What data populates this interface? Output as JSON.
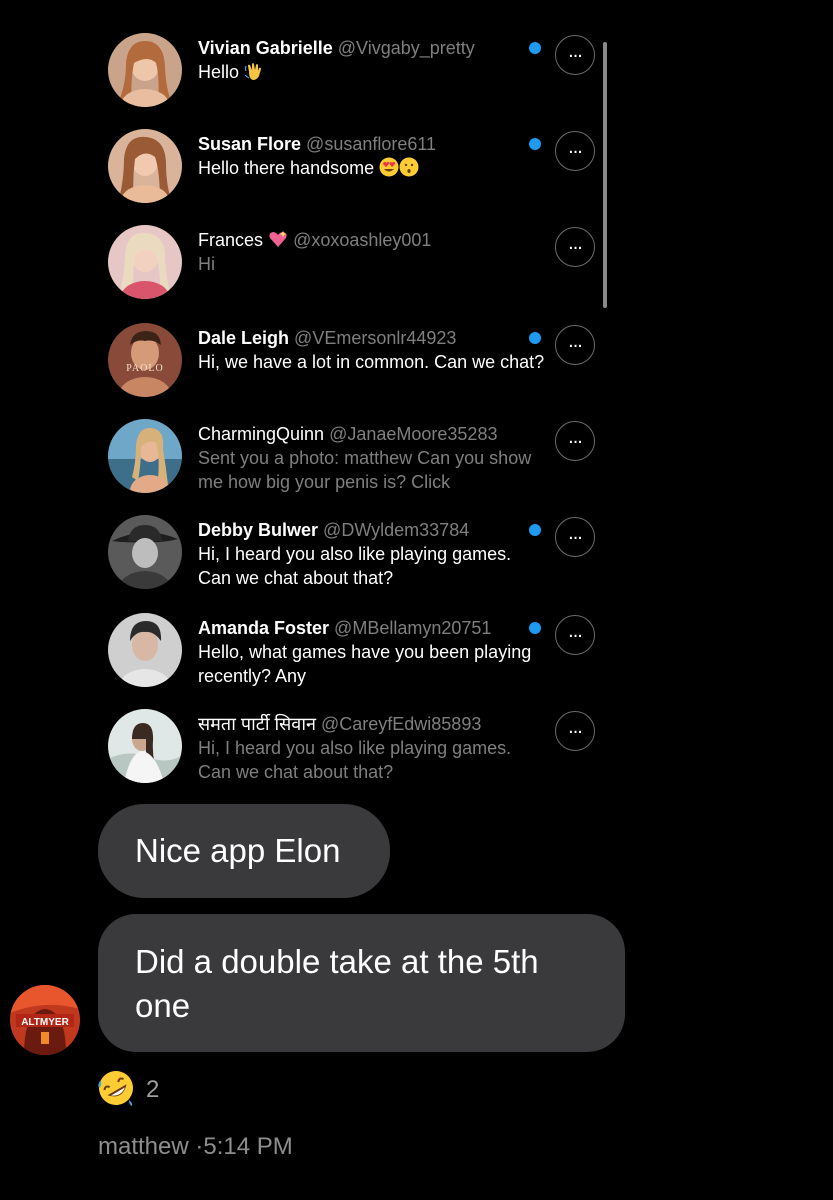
{
  "dm_list": [
    {
      "name": "Vivian Gabrielle",
      "handle": "@Vivgaby_pretty",
      "message": "Hello",
      "message_emoji": "waving-hand",
      "unread": true,
      "read_style": false
    },
    {
      "name": "Susan Flore",
      "handle": "@susanflore611",
      "message": "Hello there handsome",
      "message_emoji": "heart-eyes,kissing-face",
      "unread": true,
      "read_style": false
    },
    {
      "name": "Frances",
      "name_emoji": "sparkling-heart",
      "handle": "@xoxoashley001",
      "message": "Hi",
      "unread": false,
      "read_style": true
    },
    {
      "name": "Dale Leigh",
      "handle": "@VEmersonlr44923",
      "message": "Hi, we have a lot in common. Can we chat?",
      "avatar_text": "PAOLO",
      "unread": true,
      "read_style": false
    },
    {
      "name": "CharmingQuinn",
      "handle": "@JanaeMoore35283",
      "message": "Sent you a photo: matthew Can you show me how big your penis is? Click",
      "unread": false,
      "read_style": true
    },
    {
      "name": "Debby Bulwer",
      "handle": "@DWyldem33784",
      "message": "Hi, I heard you also like playing games. Can we chat about that?",
      "unread": true,
      "read_style": false
    },
    {
      "name": "Amanda Foster",
      "handle": "@MBellamyn20751",
      "message": "Hello, what games have you been playing recently? Any",
      "unread": true,
      "read_style": false
    },
    {
      "name": "समता पार्टी सिवान",
      "handle": "@CareyfEdwi85893",
      "message": "Hi, I heard you also like playing games. Can we chat about that?",
      "unread": false,
      "read_style": true
    }
  ],
  "chat": {
    "messages": [
      "Nice app Elon",
      "Did a double take at the 5th one"
    ],
    "sender_avatar_text": "ALTMYER",
    "reaction": {
      "emoji": "rolling-on-floor-laughing",
      "count": "2"
    },
    "sender": "matthew",
    "separator": "·",
    "time": "5:14 PM"
  },
  "colors": {
    "bubble": "#3a3a3c",
    "unread_dot": "#1d9bf0",
    "muted": "#7f7f7f"
  }
}
